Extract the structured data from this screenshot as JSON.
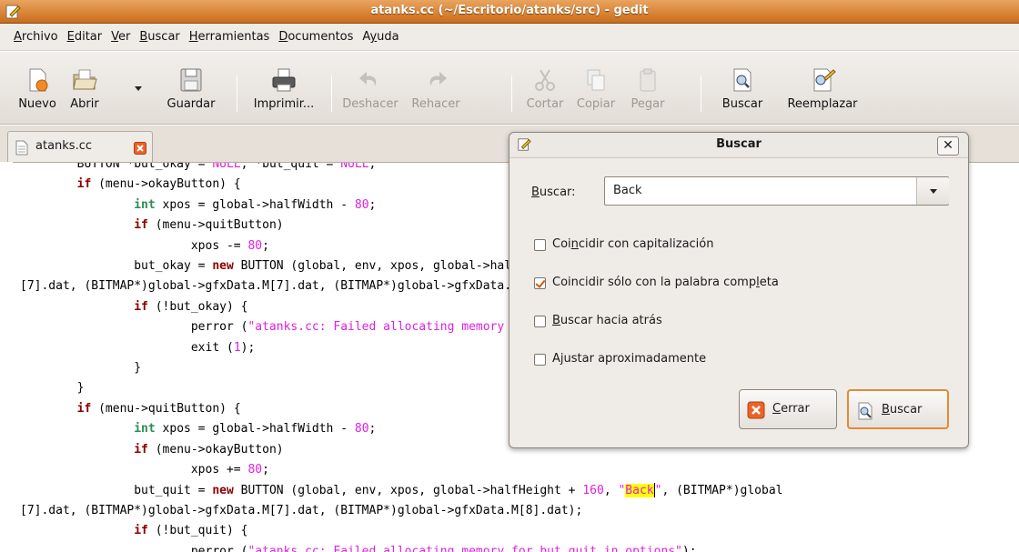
{
  "window": {
    "title": "atanks.cc (~/Escritorio/atanks/src) - gedit"
  },
  "menu": [
    {
      "u": "A",
      "rest": "rchivo"
    },
    {
      "u": "E",
      "rest": "ditar"
    },
    {
      "u": "V",
      "rest": "er"
    },
    {
      "u": "B",
      "rest": "uscar"
    },
    {
      "u": "H",
      "rest": "erramientas"
    },
    {
      "u": "D",
      "rest": "ocumentos"
    },
    {
      "pre": "A",
      "u": "y",
      "rest": "uda"
    }
  ],
  "toolbar": {
    "new": "Nuevo",
    "open": "Abrir",
    "save": "Guardar",
    "print": "Imprimir...",
    "undo": "Deshacer",
    "redo": "Rehacer",
    "cut": "Cortar",
    "copy": "Copiar",
    "paste": "Pegar",
    "find": "Buscar",
    "replace": "Reemplazar"
  },
  "tab": {
    "label": "atanks.cc"
  },
  "dialog": {
    "title": "Buscar",
    "search_label_u": "B",
    "search_label_rest": "uscar:",
    "search_value": "Back",
    "options": [
      {
        "pre": "Coi",
        "u": "n",
        "rest": "cidir con capitalización",
        "checked": false
      },
      {
        "pre": "Coincidir sólo con la palabra comp",
        "u": "l",
        "rest": "eta",
        "checked": true
      },
      {
        "pre": "",
        "u": "B",
        "rest": "uscar hacia atrás",
        "checked": false
      },
      {
        "pre": "A",
        "u": "j",
        "rest": "ustar aproximadamente",
        "checked": false
      }
    ],
    "close_u": "C",
    "close_rest": "errar",
    "find_u": "B",
    "find_rest": "uscar"
  },
  "colors": {
    "titlebar": "#d9873b",
    "keyword": "#8b0000",
    "type": "#2e8b57",
    "string_number": "#e020e0",
    "match_highlight": "#ffff00"
  }
}
